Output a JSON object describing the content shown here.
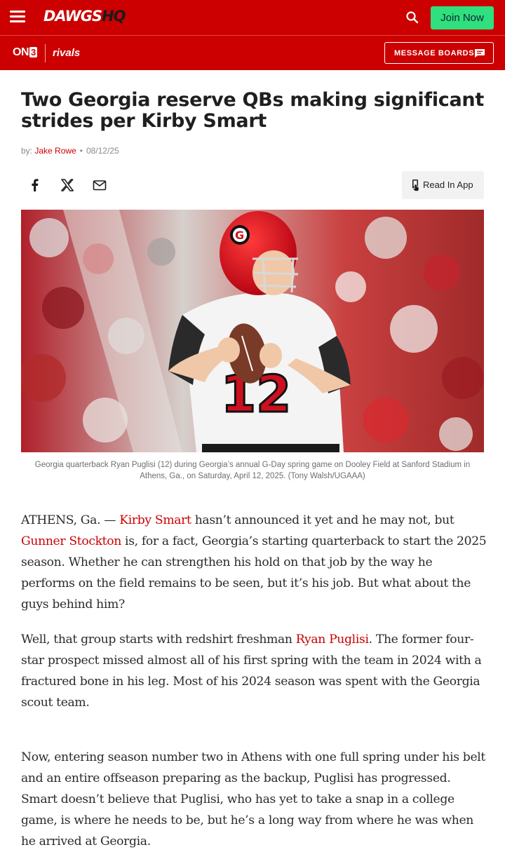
{
  "header": {
    "logo_part1": "DAWGS",
    "logo_part2": "HQ",
    "join_label": "Join Now",
    "on3_text": "ON",
    "on3_num": "3",
    "rivals": "rivals",
    "message_boards": "MESSAGE BOARDS"
  },
  "article": {
    "title": "Two Georgia reserve QBs making significant strides per Kirby Smart",
    "by_prefix": "by:",
    "author": "Jake Rowe",
    "separator": "•",
    "date": "08/12/25",
    "read_in_app": "Read In App",
    "image_caption": "Georgia quarterback Ryan Puglisi (12) during Georgia’s annual G-Day spring game on Dooley Field at Sanford Stadium in Athens, Ga., on Saturday, April 12, 2025. (Tony Walsh/UGAAA)",
    "jersey_number": "12",
    "p1": {
      "a": "ATHENS, Ga. — ",
      "link1": "Kirby Smart",
      "b": " hasn’t announced it yet and he may not, but ",
      "link2": "Gunner Stockton",
      "c": " is, for a fact, Georgia’s starting quarterback to start the 2025 season. Whether he can strengthen his hold on that job by the way he performs on the field remains to be seen, but it’s his job. But what about the guys behind him?"
    },
    "p2": {
      "a": "Well, that group starts with redshirt freshman ",
      "link1": "Ryan Puglisi",
      "b": ". The former four-star prospect missed almost all of his first spring with the team in 2024 with a fractured bone in his leg. Most of his 2024 season was spent with the Georgia scout team."
    },
    "p3": "Now, entering season number two in Athens with one full spring under his belt and an entire offseason preparing as the backup, Puglisi has progressed. Smart doesn’t believe that Puglisi, who has yet to take a snap in a college game, is where he needs to be, but he’s a long way from where he was when he arrived at Georgia."
  },
  "colors": {
    "brand_red": "#cc0000",
    "join_green": "#2fe07e",
    "link_red": "#cc0000"
  },
  "icons": {
    "menu": "hamburger-icon",
    "search": "search-icon",
    "boards": "chat-icon",
    "facebook": "facebook-icon",
    "x": "x-icon",
    "email": "email-icon",
    "app": "phone-tap-icon"
  }
}
